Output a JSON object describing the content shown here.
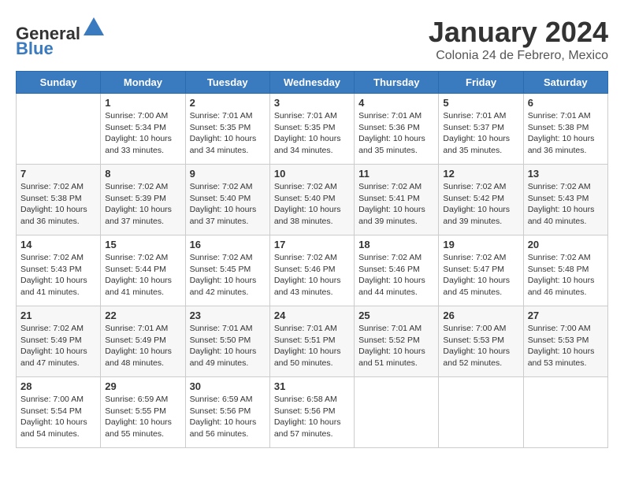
{
  "header": {
    "logo_general": "General",
    "logo_blue": "Blue",
    "month_title": "January 2024",
    "subtitle": "Colonia 24 de Febrero, Mexico"
  },
  "days_of_week": [
    "Sunday",
    "Monday",
    "Tuesday",
    "Wednesday",
    "Thursday",
    "Friday",
    "Saturday"
  ],
  "weeks": [
    [
      {
        "day": "",
        "info": ""
      },
      {
        "day": "1",
        "info": "Sunrise: 7:00 AM\nSunset: 5:34 PM\nDaylight: 10 hours\nand 33 minutes."
      },
      {
        "day": "2",
        "info": "Sunrise: 7:01 AM\nSunset: 5:35 PM\nDaylight: 10 hours\nand 34 minutes."
      },
      {
        "day": "3",
        "info": "Sunrise: 7:01 AM\nSunset: 5:35 PM\nDaylight: 10 hours\nand 34 minutes."
      },
      {
        "day": "4",
        "info": "Sunrise: 7:01 AM\nSunset: 5:36 PM\nDaylight: 10 hours\nand 35 minutes."
      },
      {
        "day": "5",
        "info": "Sunrise: 7:01 AM\nSunset: 5:37 PM\nDaylight: 10 hours\nand 35 minutes."
      },
      {
        "day": "6",
        "info": "Sunrise: 7:01 AM\nSunset: 5:38 PM\nDaylight: 10 hours\nand 36 minutes."
      }
    ],
    [
      {
        "day": "7",
        "info": "Sunrise: 7:02 AM\nSunset: 5:38 PM\nDaylight: 10 hours\nand 36 minutes."
      },
      {
        "day": "8",
        "info": "Sunrise: 7:02 AM\nSunset: 5:39 PM\nDaylight: 10 hours\nand 37 minutes."
      },
      {
        "day": "9",
        "info": "Sunrise: 7:02 AM\nSunset: 5:40 PM\nDaylight: 10 hours\nand 37 minutes."
      },
      {
        "day": "10",
        "info": "Sunrise: 7:02 AM\nSunset: 5:40 PM\nDaylight: 10 hours\nand 38 minutes."
      },
      {
        "day": "11",
        "info": "Sunrise: 7:02 AM\nSunset: 5:41 PM\nDaylight: 10 hours\nand 39 minutes."
      },
      {
        "day": "12",
        "info": "Sunrise: 7:02 AM\nSunset: 5:42 PM\nDaylight: 10 hours\nand 39 minutes."
      },
      {
        "day": "13",
        "info": "Sunrise: 7:02 AM\nSunset: 5:43 PM\nDaylight: 10 hours\nand 40 minutes."
      }
    ],
    [
      {
        "day": "14",
        "info": "Sunrise: 7:02 AM\nSunset: 5:43 PM\nDaylight: 10 hours\nand 41 minutes."
      },
      {
        "day": "15",
        "info": "Sunrise: 7:02 AM\nSunset: 5:44 PM\nDaylight: 10 hours\nand 41 minutes."
      },
      {
        "day": "16",
        "info": "Sunrise: 7:02 AM\nSunset: 5:45 PM\nDaylight: 10 hours\nand 42 minutes."
      },
      {
        "day": "17",
        "info": "Sunrise: 7:02 AM\nSunset: 5:46 PM\nDaylight: 10 hours\nand 43 minutes."
      },
      {
        "day": "18",
        "info": "Sunrise: 7:02 AM\nSunset: 5:46 PM\nDaylight: 10 hours\nand 44 minutes."
      },
      {
        "day": "19",
        "info": "Sunrise: 7:02 AM\nSunset: 5:47 PM\nDaylight: 10 hours\nand 45 minutes."
      },
      {
        "day": "20",
        "info": "Sunrise: 7:02 AM\nSunset: 5:48 PM\nDaylight: 10 hours\nand 46 minutes."
      }
    ],
    [
      {
        "day": "21",
        "info": "Sunrise: 7:02 AM\nSunset: 5:49 PM\nDaylight: 10 hours\nand 47 minutes."
      },
      {
        "day": "22",
        "info": "Sunrise: 7:01 AM\nSunset: 5:49 PM\nDaylight: 10 hours\nand 48 minutes."
      },
      {
        "day": "23",
        "info": "Sunrise: 7:01 AM\nSunset: 5:50 PM\nDaylight: 10 hours\nand 49 minutes."
      },
      {
        "day": "24",
        "info": "Sunrise: 7:01 AM\nSunset: 5:51 PM\nDaylight: 10 hours\nand 50 minutes."
      },
      {
        "day": "25",
        "info": "Sunrise: 7:01 AM\nSunset: 5:52 PM\nDaylight: 10 hours\nand 51 minutes."
      },
      {
        "day": "26",
        "info": "Sunrise: 7:00 AM\nSunset: 5:53 PM\nDaylight: 10 hours\nand 52 minutes."
      },
      {
        "day": "27",
        "info": "Sunrise: 7:00 AM\nSunset: 5:53 PM\nDaylight: 10 hours\nand 53 minutes."
      }
    ],
    [
      {
        "day": "28",
        "info": "Sunrise: 7:00 AM\nSunset: 5:54 PM\nDaylight: 10 hours\nand 54 minutes."
      },
      {
        "day": "29",
        "info": "Sunrise: 6:59 AM\nSunset: 5:55 PM\nDaylight: 10 hours\nand 55 minutes."
      },
      {
        "day": "30",
        "info": "Sunrise: 6:59 AM\nSunset: 5:56 PM\nDaylight: 10 hours\nand 56 minutes."
      },
      {
        "day": "31",
        "info": "Sunrise: 6:58 AM\nSunset: 5:56 PM\nDaylight: 10 hours\nand 57 minutes."
      },
      {
        "day": "",
        "info": ""
      },
      {
        "day": "",
        "info": ""
      },
      {
        "day": "",
        "info": ""
      }
    ]
  ]
}
